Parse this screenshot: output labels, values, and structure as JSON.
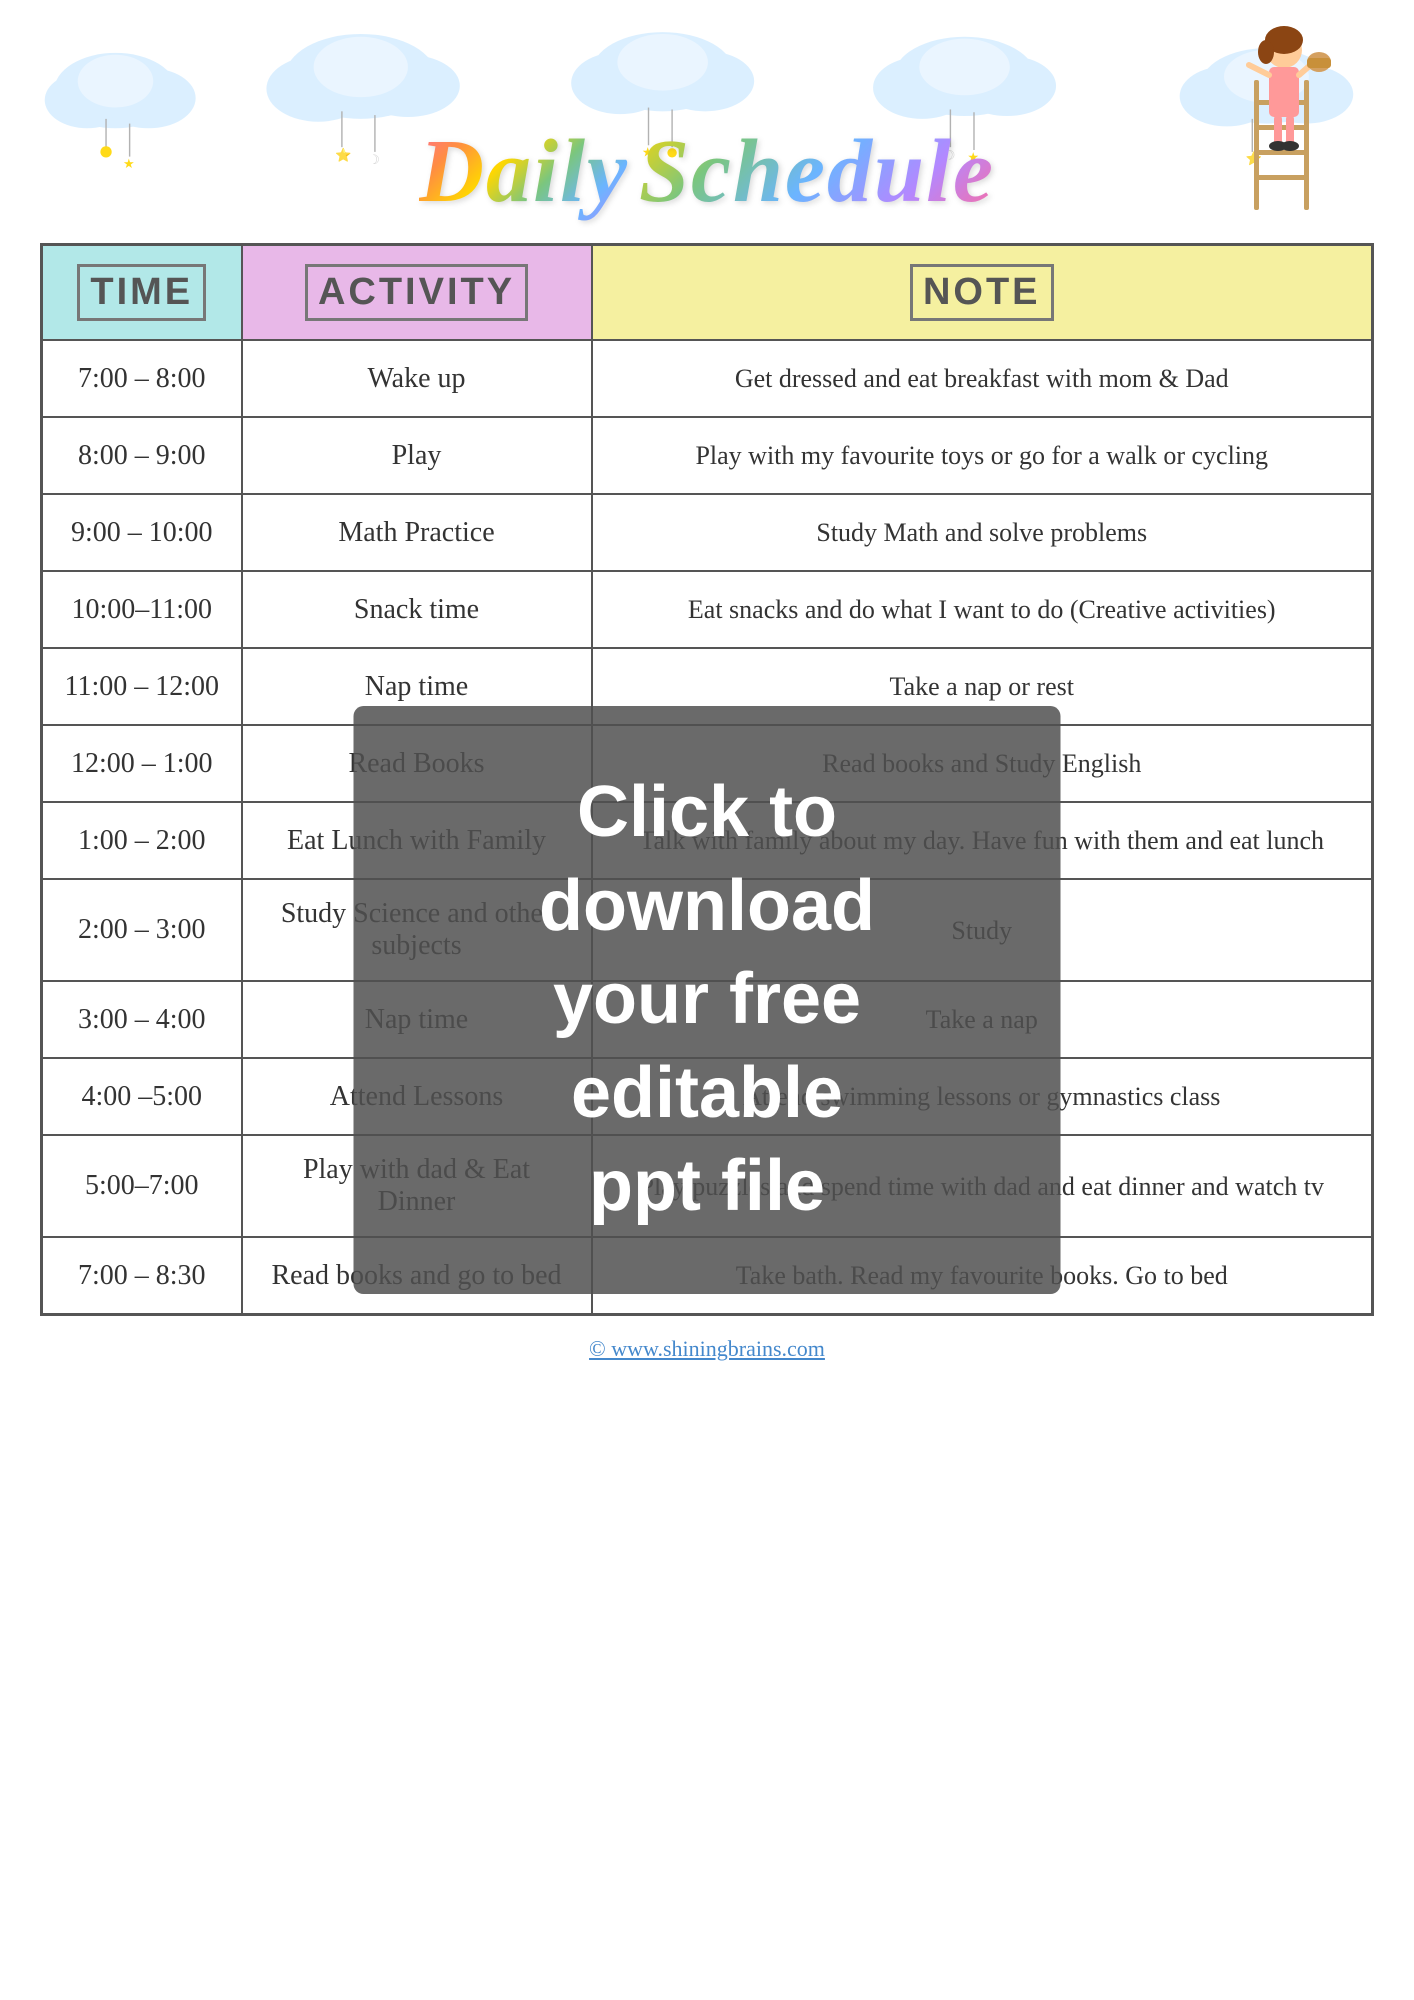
{
  "header": {
    "title_daily": "Daily",
    "title_schedule": "Schedule"
  },
  "table": {
    "headers": {
      "time": "TIME",
      "activity": "ACTIVITY",
      "note": "NOTE"
    },
    "rows": [
      {
        "time": "7:00 – 8:00",
        "activity": "Wake up",
        "note": "Get dressed and eat breakfast with mom & Dad"
      },
      {
        "time": "8:00 – 9:00",
        "activity": "Play",
        "note": "Play with my favourite toys or go for a walk or cycling"
      },
      {
        "time": "9:00 – 10:00",
        "activity": "Math Practice",
        "note": "Study Math and solve problems"
      },
      {
        "time": "10:00–11:00",
        "activity": "Snack time",
        "note": "Eat snacks and do what I want to do (Creative activities)"
      },
      {
        "time": "11:00 – 12:00",
        "activity": "Nap time",
        "note": "Take a nap or rest"
      },
      {
        "time": "12:00 – 1:00",
        "activity": "Read Books",
        "note": "Read books and Study English"
      },
      {
        "time": "1:00 – 2:00",
        "activity": "Eat Lunch with Family",
        "note": "Talk with family about my day. Have fun with them and eat lunch"
      },
      {
        "time": "2:00 – 3:00",
        "activity": "Study Science and other subjects",
        "note": "Study"
      },
      {
        "time": "3:00 – 4:00",
        "activity": "Nap time",
        "note": "Take a nap"
      },
      {
        "time": "4:00 –5:00",
        "activity": "Attend Lessons",
        "note": "Attend swimming lessons or gymnastics class"
      },
      {
        "time": "5:00–7:00",
        "activity": "Play with dad & Eat Dinner",
        "note": "Play puzzles and spend time with dad and eat dinner and watch tv"
      },
      {
        "time": "7:00 – 8:30",
        "activity": "Read books and go to bed",
        "note": "Take bath. Read my favourite books. Go to bed"
      }
    ]
  },
  "watermark": {
    "line1": "Click to download",
    "line2": "your free editable",
    "line3": "ppt file"
  },
  "footer": {
    "website": "© www.shiningbrains.com"
  }
}
